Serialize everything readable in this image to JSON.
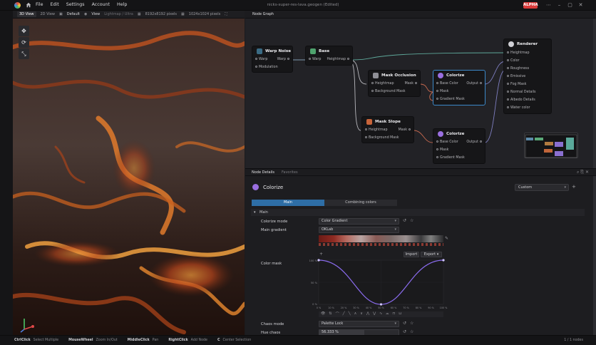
{
  "titlebar": {
    "menus": [
      "File",
      "Edit",
      "Settings",
      "Account",
      "Help"
    ],
    "window_title": "nicks-super-res-lava.geogen (Edited)",
    "badge": "ALPHA"
  },
  "viewport_toolbar": {
    "tabs": [
      "3D View",
      "2D View"
    ],
    "preset": "Default",
    "view_menu": "View",
    "lighting": "Lightmap / Ultra",
    "res1": "8192x8192 pixels",
    "res2": "1024x1024 pixels"
  },
  "node_graph": {
    "tab": "Node Graph",
    "nodes": {
      "warp_noise": {
        "title": "Warp Noise",
        "in1": "Warp",
        "in2": "Modulation",
        "out1": "Warp"
      },
      "base": {
        "title": "Base",
        "in1": "Warp",
        "out1": "Heightmap"
      },
      "mask_occlusion": {
        "title": "Mask Occlusion",
        "in1": "Heightmap",
        "in2": "Background Mask",
        "out1": "Mask"
      },
      "mask_slope": {
        "title": "Mask Slope",
        "in1": "Heightmap",
        "in2": "Background Mask",
        "out1": "Mask"
      },
      "colorize1": {
        "title": "Colorize",
        "in1": "Base Color",
        "in2": "Mask",
        "in3": "Gradient Mask",
        "out1": "Output"
      },
      "colorize2": {
        "title": "Colorize",
        "in1": "Base Color",
        "in2": "Mask",
        "in3": "Gradient Mask",
        "out1": "Output"
      },
      "renderer": {
        "title": "Renderer",
        "inputs": [
          "Heightmap",
          "Color",
          "Roughness",
          "Emissive",
          "Fog Mask",
          "Normal Details",
          "Albedo Details",
          "Water color"
        ]
      }
    }
  },
  "details": {
    "tabs": [
      "Node Details",
      "Favorites"
    ],
    "node_title": "Colorize",
    "preset": "Custom",
    "subtabs": [
      "Main",
      "Combining colors"
    ],
    "section": "Main",
    "colorize_mode": {
      "label": "Colorize mode",
      "value": "Color Gradient"
    },
    "main_gradient": {
      "label": "Main gradient",
      "value": "OKLab"
    },
    "import_label": "Import",
    "export_label": "Export",
    "color_mask": {
      "label": "Color mask",
      "y_ticks": [
        "100 %",
        "50 %",
        "0 %"
      ],
      "x_ticks": [
        "0 %",
        "10 %",
        "20 %",
        "30 %",
        "40 %",
        "50 %",
        "60 %",
        "70 %",
        "80 %",
        "90 %",
        "100 %"
      ]
    },
    "chaos_mode": {
      "label": "Chaos mode",
      "value": "Palette Lock"
    },
    "hue_chaos": {
      "label": "Hue chaos",
      "value": "56.333",
      "unit": "%",
      "fill": 0.5633
    }
  },
  "statusbar": {
    "hints": [
      {
        "key": "CtrlClick",
        "text": "Select Multiple"
      },
      {
        "key": "MouseWheel",
        "text": "Zoom In/Out"
      },
      {
        "key": "MiddleClick",
        "text": "Pan"
      },
      {
        "key": "RightClick",
        "text": "Add Node"
      },
      {
        "key": "C",
        "text": "Center Selection"
      }
    ],
    "right": "1 / 1 nodes"
  },
  "colors": {
    "accent": "#3c88c8",
    "badge": "#d93a3a",
    "curve": "#8b6cf0"
  }
}
